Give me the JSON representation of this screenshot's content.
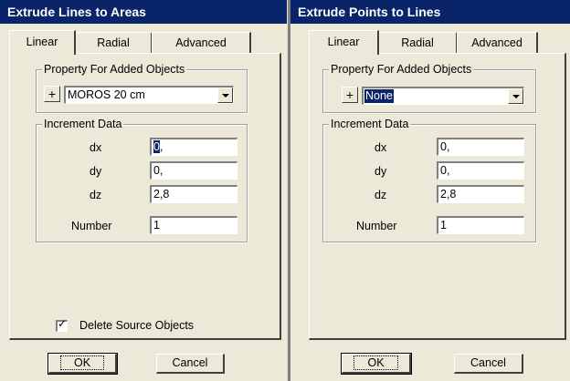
{
  "left_dialog": {
    "title": "Extrude Lines to Areas",
    "tabs": [
      "Linear",
      "Radial",
      "Advanced"
    ],
    "property_group_label": "Property For Added Objects",
    "add_button_label": "+",
    "property_value": "MOROS 20 cm",
    "increment_group_label": "Increment Data",
    "fields": {
      "dx": {
        "label": "dx",
        "value": "0,"
      },
      "dy": {
        "label": "dy",
        "value": "0,"
      },
      "dz": {
        "label": "dz",
        "value": "2,8"
      },
      "number": {
        "label": "Number",
        "value": "1"
      }
    },
    "dx_highlight": "0",
    "dx_rest": ",",
    "delete_source_label": "Delete Source Objects",
    "delete_source_checked": true,
    "check_mark": "✓",
    "ok_label": "OK",
    "cancel_label": "Cancel"
  },
  "right_dialog": {
    "title": "Extrude Points to Lines",
    "tabs": [
      "Linear",
      "Radial",
      "Advanced"
    ],
    "property_group_label": "Property For Added Objects",
    "add_button_label": "+",
    "property_value": "None",
    "increment_group_label": "Increment Data",
    "fields": {
      "dx": {
        "label": "dx",
        "value": "0,"
      },
      "dy": {
        "label": "dy",
        "value": "0,"
      },
      "dz": {
        "label": "dz",
        "value": "2,8"
      },
      "number": {
        "label": "Number",
        "value": "1"
      }
    },
    "ok_label": "OK",
    "cancel_label": "Cancel"
  },
  "colors": {
    "titlebar": "#0a246a",
    "face": "#ece9d8",
    "selection": "#0a246a"
  }
}
